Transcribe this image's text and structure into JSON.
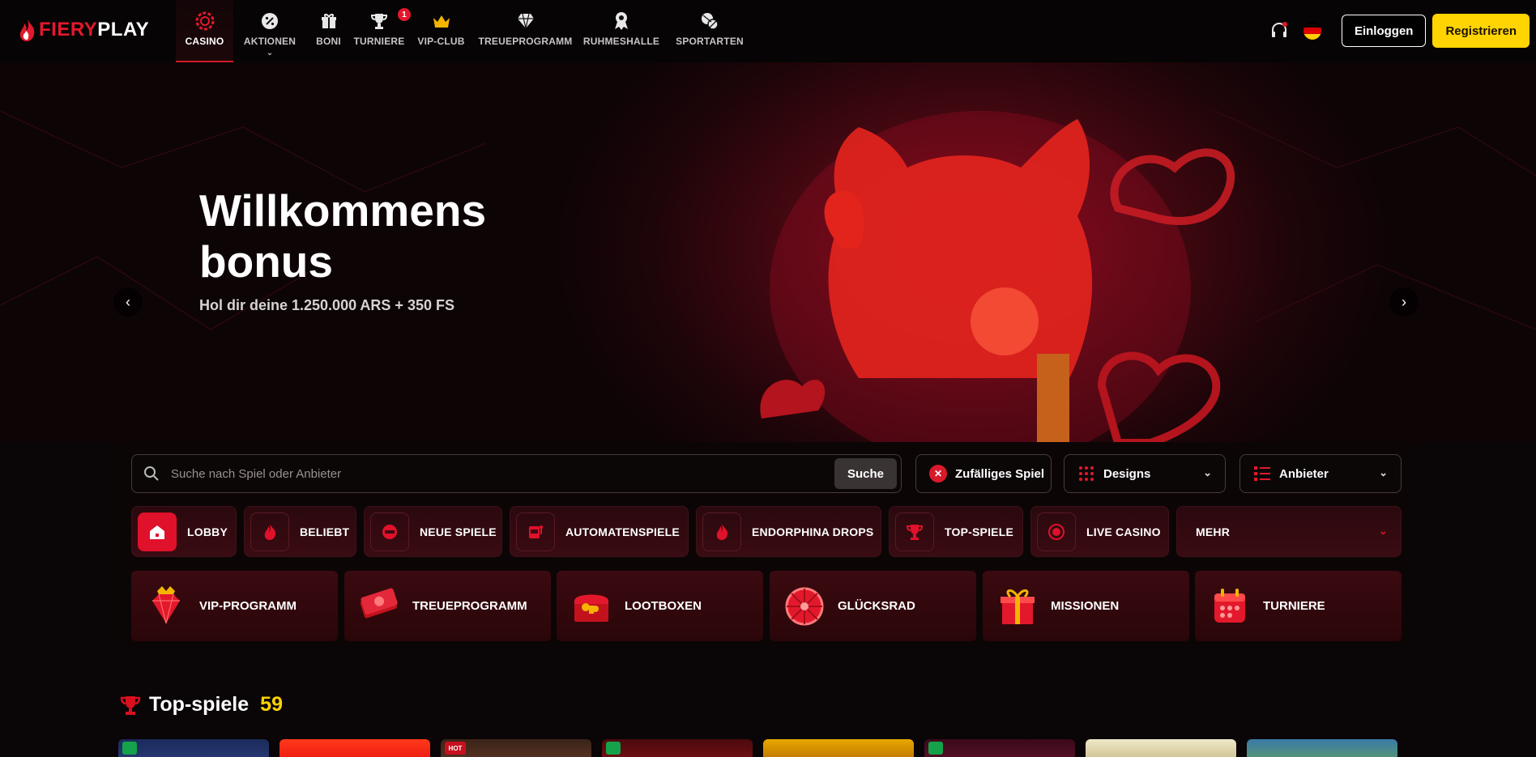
{
  "brand": {
    "part1": "FIERY",
    "part2": "PLAY"
  },
  "nav": {
    "items": [
      {
        "label": "CASINO",
        "icon": "casino-chip-icon"
      },
      {
        "label": "AKTIONEN",
        "icon": "percent-badge-icon"
      },
      {
        "label": "BONI",
        "icon": "gift-icon"
      },
      {
        "label": "TURNIERE",
        "icon": "trophy-icon",
        "badge": "1"
      },
      {
        "label": "VIP-CLUB",
        "icon": "crown-icon"
      },
      {
        "label": "TREUEPROGRAMM",
        "icon": "diamond-icon"
      },
      {
        "label": "RUHMESHALLE",
        "icon": "medal-icon"
      },
      {
        "label": "SPORTARTEN",
        "icon": "sports-ball-icon"
      }
    ],
    "login": "Einloggen",
    "register": "Registrieren"
  },
  "hero": {
    "title_line1": "Willkommens",
    "title_line2": "bonus",
    "subtitle": "Hol dir deine 1.250.000 ARS + 350 FS"
  },
  "search": {
    "placeholder": "Suche nach Spiel oder Anbieter",
    "button": "Suche",
    "random": "Zufälliges Spiel",
    "designs": "Designs",
    "providers": "Anbieter"
  },
  "categories": [
    {
      "label": "LOBBY",
      "icon": "home-icon"
    },
    {
      "label": "BELIEBT",
      "icon": "flame-icon"
    },
    {
      "label": "NEUE SPIELE",
      "icon": "new-badge-icon"
    },
    {
      "label": "AUTOMATENSPIELE",
      "icon": "slot-machine-icon"
    },
    {
      "label": "ENDORPHINA DROPS",
      "icon": "flame-icon"
    },
    {
      "label": "TOP-SPIELE",
      "icon": "trophy-icon"
    },
    {
      "label": "LIVE CASINO",
      "icon": "live-icon"
    },
    {
      "label": "MEHR",
      "icon": ""
    }
  ],
  "features": [
    {
      "label": "VIP-PROGRAMM",
      "icon": "ruby-icon"
    },
    {
      "label": "TREUEPROGRAMM",
      "icon": "cash-stack-icon"
    },
    {
      "label": "LOOTBOXEN",
      "icon": "treasure-chest-icon"
    },
    {
      "label": "GLÜCKSRAD",
      "icon": "wheel-icon"
    },
    {
      "label": "MISSIONEN",
      "icon": "gift-box-icon"
    },
    {
      "label": "TURNIERE",
      "icon": "calendar-icon"
    }
  ],
  "top_games": {
    "title": "Top-spiele",
    "count": "59",
    "hot_badge": "HOT"
  },
  "colors": {
    "accent": "#e3182c",
    "cta": "#ffd400",
    "panel": "#0c0506"
  }
}
